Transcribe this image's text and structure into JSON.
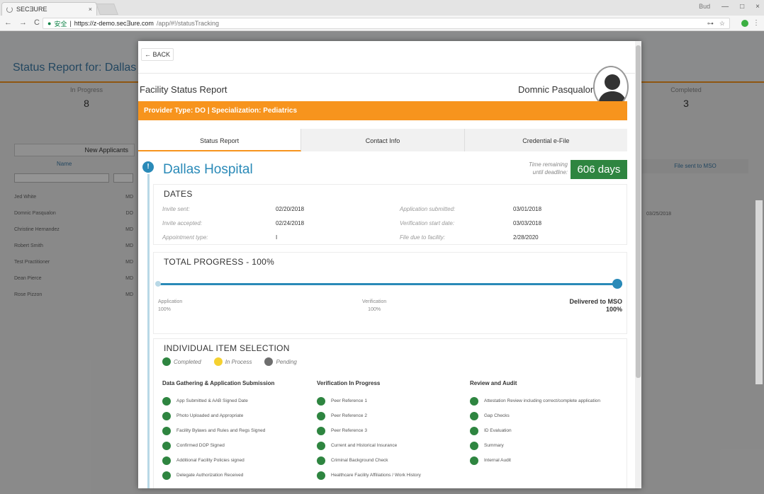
{
  "browser": {
    "tab_title": "SECƎURE",
    "tab_close": "×",
    "user_label": "Bud",
    "win_min": "—",
    "win_max": "□",
    "win_close": "×",
    "nav_back": "←",
    "nav_forward": "→",
    "nav_reload": "C",
    "secure_label": "安全",
    "url_domain": "https://z-demo.secƎure.com",
    "url_path": "/app/#!/statusTracking",
    "key_icon": "⊶",
    "star_icon": "☆",
    "menu_icon": "⋮"
  },
  "app": {
    "title": "Status Report for: Dallas Ho",
    "stats": [
      {
        "label": "In Progress",
        "value": "8"
      },
      {
        "label": "Completed",
        "value": "3"
      }
    ],
    "new_applicants_tab": "New Applicants",
    "col_name": "Name",
    "col_file_sent": "File sent to MSO",
    "rows": [
      {
        "name": "Jed White",
        "type": "MD"
      },
      {
        "name": "Domnic Pasqualon",
        "type": "DO"
      },
      {
        "name": "Christine Hernandez",
        "type": "MD"
      },
      {
        "name": "Robert Smith",
        "type": "MD"
      },
      {
        "name": "Test Practitioner",
        "type": "MD"
      },
      {
        "name": "Dean Pierce",
        "type": "MD"
      },
      {
        "name": "Rose Pizzon",
        "type": "MD"
      }
    ],
    "row_date": "03/25/2018"
  },
  "modal": {
    "back_label": "← BACK",
    "report_title": "Facility Status Report",
    "provider_name": "Domnic Pasqualoni",
    "provider_bar": "Provider Type: DO | Specialization: Pediatrics",
    "tabs": [
      {
        "label": "Status Report",
        "active": true
      },
      {
        "label": "Contact Info",
        "active": false
      },
      {
        "label": "Credential e-File",
        "active": false
      }
    ],
    "hospital_name": "Dallas Hospital",
    "time_remaining_line1": "Time remaining",
    "time_remaining_line2": "until deadline:",
    "days_remaining": "606 days",
    "dates": {
      "title": "DATES",
      "rows": [
        {
          "k": "Invite sent:",
          "v": "02/20/2018",
          "k2": "Application submitted:",
          "v2": "03/01/2018"
        },
        {
          "k": "Invite accepted:",
          "v": "02/24/2018",
          "k2": "Verification start date:",
          "v2": "03/03/2018"
        },
        {
          "k": "Appointment type:",
          "v": "I",
          "k2": "File due to facility:",
          "v2": "2/28/2020"
        }
      ]
    },
    "progress": {
      "title": "TOTAL PROGRESS - 100%",
      "percent": 100,
      "stages": [
        {
          "name": "Application",
          "pct": "100%"
        },
        {
          "name": "Verification",
          "pct": "100%"
        },
        {
          "name": "Delivered to MSO",
          "pct": "100%"
        }
      ]
    },
    "items": {
      "title": "INDIVIDUAL ITEM SELECTION",
      "legend": {
        "completed": "Completed",
        "in_process": "In Process",
        "pending": "Pending",
        "completed_color": "#2e8540",
        "in_process_color": "#f5d130",
        "pending_color": "#6e6e6e"
      },
      "columns": [
        {
          "title": "Data Gathering & Application Submission",
          "items": [
            "App Submitted & AAB Signed Date",
            "Photo Uploaded and Appropriate",
            "Facility Bylaws and Rules and Regs Signed",
            "Confirmed DOP Signed",
            "Additional Facility Policies signed",
            "Delegate Authorization Received"
          ]
        },
        {
          "title": "Verification In Progress",
          "items": [
            "Peer Reference 1",
            "Peer Reference 2",
            "Peer Reference 3",
            "Current and Historical Insurance",
            "Criminal Background Check",
            "Healthcare Facility Affiliations / Work History"
          ]
        },
        {
          "title": "Review and Audit",
          "items": [
            "Attestation Review including correct/complete application",
            "Gap Checks",
            "ID Evaluation",
            "Summary",
            "Internal Audit"
          ]
        }
      ]
    }
  }
}
